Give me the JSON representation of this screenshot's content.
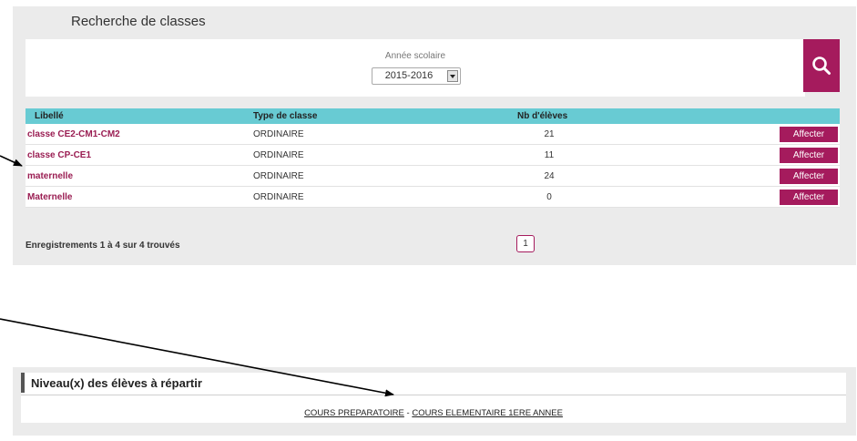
{
  "search": {
    "title": "Recherche de classes",
    "year_label": "Année scolaire",
    "year_value": "2015-2016",
    "search_icon": "search-icon"
  },
  "table": {
    "headers": [
      "Libellé",
      "Type de classe",
      "Nb d'élèves"
    ],
    "rows": [
      {
        "libelle": "classe CE2-CM1-CM2",
        "type": "ORDINAIRE",
        "nb": "21",
        "action": "Affecter"
      },
      {
        "libelle": "classe CP-CE1",
        "type": "ORDINAIRE",
        "nb": "11",
        "action": "Affecter"
      },
      {
        "libelle": "maternelle",
        "type": "ORDINAIRE",
        "nb": "24",
        "action": "Affecter"
      },
      {
        "libelle": "Maternelle",
        "type": "ORDINAIRE",
        "nb": "0",
        "action": "Affecter"
      }
    ]
  },
  "pagination": {
    "records_text": "Enregistrements 1 à 4 sur 4 trouvés",
    "current_page": "1"
  },
  "levels": {
    "title": "Niveau(x) des élèves à répartir",
    "items": [
      "COURS PREPARATOIRE",
      "COURS ELEMENTAIRE 1ERE ANNEE"
    ],
    "separator": " - "
  },
  "colors": {
    "accent": "#a51b5d",
    "table_header": "#68cbd3",
    "panel_bg": "#ebebeb"
  }
}
